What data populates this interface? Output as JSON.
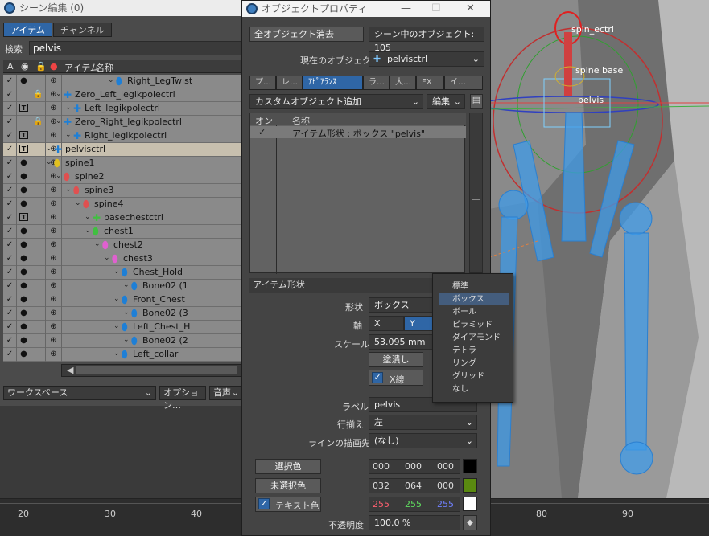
{
  "scene_editor": {
    "title": "シーン編集 (0)",
    "tabs": [
      "アイテム",
      "チャンネル"
    ],
    "search_label": "検索",
    "search_value": "pelvis",
    "columns": {
      "a": "A",
      "item": "アイテム",
      "name": "名称"
    },
    "rows": [
      {
        "name": "Right_LegTwist",
        "icon": "bone-icon",
        "color": "#1e7fd6",
        "indent": 210,
        "col2": "•"
      },
      {
        "name": "Zero_Left_legikpolectrl",
        "icon": "locator-icon",
        "color": "#1e7fd6",
        "indent": 145,
        "col2": "",
        "lock": true
      },
      {
        "name": "Left_legikpolectrl",
        "icon": "locator-icon",
        "color": "#1e7fd6",
        "indent": 157,
        "col2": "T"
      },
      {
        "name": "Zero_Right_legikpolectrl",
        "icon": "locator-icon",
        "color": "#1e7fd6",
        "indent": 145,
        "col2": "",
        "lock": true
      },
      {
        "name": "Right_legikpolectrl",
        "icon": "locator-icon",
        "color": "#1e7fd6",
        "indent": 157,
        "col2": "T"
      },
      {
        "name": "pelvisctrl",
        "icon": "locator-icon",
        "color": "#1e7fd6",
        "indent": 133,
        "col2": "T",
        "selected": true
      },
      {
        "name": "spine1",
        "icon": "bone-icon",
        "color": "#e0c020",
        "indent": 133,
        "col2": "•"
      },
      {
        "name": "spine2",
        "icon": "bone-icon",
        "color": "#e05050",
        "indent": 145,
        "col2": "•"
      },
      {
        "name": "spine3",
        "icon": "bone-icon",
        "color": "#e05050",
        "indent": 157,
        "col2": "•"
      },
      {
        "name": "spine4",
        "icon": "bone-icon",
        "color": "#e05050",
        "indent": 169,
        "col2": "•"
      },
      {
        "name": "basechestctrl",
        "icon": "locator-icon",
        "color": "#40c040",
        "indent": 181,
        "col2": "T"
      },
      {
        "name": "chest1",
        "icon": "bone-icon",
        "color": "#40c040",
        "indent": 181,
        "col2": "•"
      },
      {
        "name": "chest2",
        "icon": "bone-icon",
        "color": "#e060d0",
        "indent": 193,
        "col2": "•"
      },
      {
        "name": "chest3",
        "icon": "bone-icon",
        "color": "#e060d0",
        "indent": 205,
        "col2": "•"
      },
      {
        "name": "Chest_Hold",
        "icon": "bone-icon",
        "color": "#1e7fd6",
        "indent": 217,
        "col2": "•"
      },
      {
        "name": "Bone02 (1",
        "icon": "bone-icon",
        "color": "#1e7fd6",
        "indent": 229,
        "col2": "•"
      },
      {
        "name": "Front_Chest",
        "icon": "bone-icon",
        "color": "#1e7fd6",
        "indent": 217,
        "col2": "•"
      },
      {
        "name": "Bone02 (3",
        "icon": "bone-icon",
        "color": "#1e7fd6",
        "indent": 229,
        "col2": "•"
      },
      {
        "name": "Left_Chest_H",
        "icon": "bone-icon",
        "color": "#1e7fd6",
        "indent": 217,
        "col2": "•"
      },
      {
        "name": "Bone02 (2",
        "icon": "bone-icon",
        "color": "#1e7fd6",
        "indent": 229,
        "col2": "•"
      },
      {
        "name": "Left_collar",
        "icon": "bone-icon",
        "color": "#1e7fd6",
        "indent": 217,
        "col2": "•"
      }
    ],
    "workspace": "ワークスペース",
    "options": "オプション…",
    "audio": "音声"
  },
  "props": {
    "title": "オブジェクトプロパティ",
    "clear_all": "全オブジェクト消去",
    "scene_objects": "シーン中のオブジェクト: 105",
    "current_label": "現在のオブジェクト",
    "current_value": "pelvisctrl",
    "tabs": [
      "プ…",
      "レ…",
      "ｱﾋﾟｱﾗﾝｽ",
      "ラ…",
      "大…",
      "FX",
      "イ…"
    ],
    "active_tab": 2,
    "add_custom": "カスタムオブジェクト追加",
    "edit": "編集",
    "list_headers": {
      "on": "オン",
      "name": "名称"
    },
    "list_items": [
      {
        "check": "✓",
        "name": "アイテム形状 : ボックス \"pelvis\""
      }
    ],
    "section_item_shape": "アイテム形状",
    "shape_label": "形状",
    "shape_value": "ボックス",
    "axis_label": "軸",
    "axis_x": "X",
    "axis_y": "Y",
    "scale_label": "スケール",
    "scale_value": "53.095 mm",
    "solid": "塗潰し",
    "xline": "X線",
    "label_label": "ラベル",
    "label_value": "pelvis",
    "align_label": "行揃え",
    "align_value": "左",
    "line_to_label": "ラインの描画先",
    "line_to_value": "(なし)",
    "sel_color": "選択色",
    "sel_rgb": [
      "000",
      "000",
      "000"
    ],
    "sel_swatch": "#000000",
    "unsel_color": "未選択色",
    "unsel_rgb": [
      "032",
      "064",
      "000"
    ],
    "unsel_swatch": "#5a8a10",
    "text_color": "テキスト色",
    "text_rgb": [
      "255",
      "255",
      "255"
    ],
    "text_swatch": "#ffffff",
    "opacity_label": "不透明度",
    "opacity_value": "100.0 %"
  },
  "shape_menu": {
    "items": [
      "標準",
      "ボックス",
      "ボール",
      "ピラミッド",
      "ダイアモンド",
      "テトラ",
      "リング",
      "グリッド",
      "なし"
    ],
    "highlighted": 1
  },
  "viewport": {
    "labels": [
      "spin_ectrl",
      "spine base",
      "pelvis"
    ]
  },
  "timeline": {
    "ticks": [
      "20",
      "30",
      "40",
      "80",
      "90"
    ]
  }
}
